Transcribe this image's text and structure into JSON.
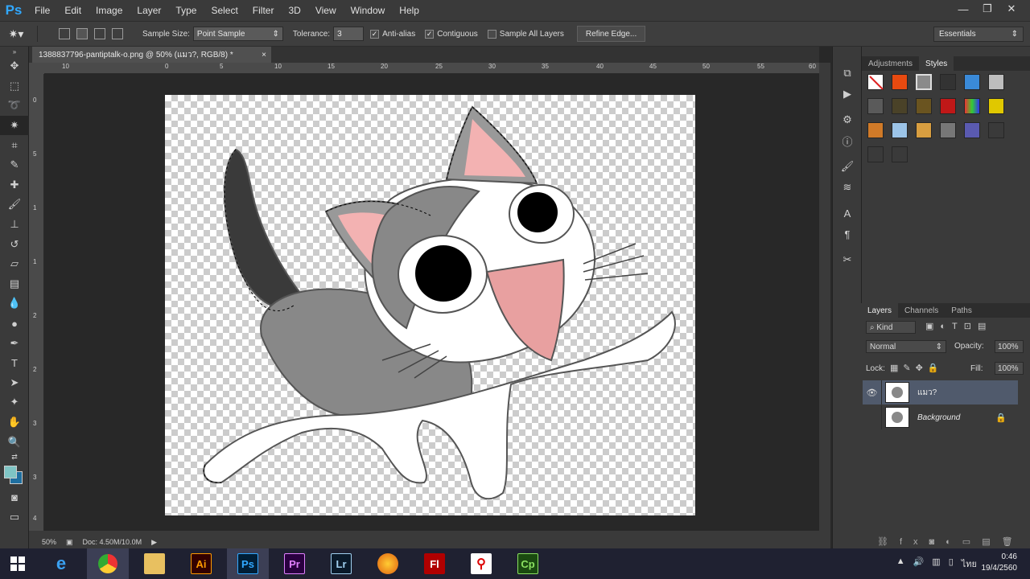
{
  "menu": {
    "logo": "Ps",
    "items": [
      "File",
      "Edit",
      "Image",
      "Layer",
      "Type",
      "Select",
      "Filter",
      "3D",
      "View",
      "Window",
      "Help"
    ]
  },
  "window_controls": {
    "minimize": "—",
    "restore": "❐",
    "close": "✕"
  },
  "options": {
    "sample_size_label": "Sample Size:",
    "sample_size_value": "Point Sample",
    "tolerance_label": "Tolerance:",
    "tolerance_value": "3",
    "antialias_label": "Anti-alias",
    "contiguous_label": "Contiguous",
    "sample_all_layers_label": "Sample All Layers",
    "refine_edge_label": "Refine Edge...",
    "workspace": "Essentials"
  },
  "document": {
    "tab_title": "1388837796-pantiptalk-o.png @ 50% (แมว?, RGB/8) *",
    "tab_close": "×",
    "zoom": "50%",
    "doc_size": "Doc: 4.50M/10.0M"
  },
  "rulers": {
    "top": [
      "10",
      "0",
      "5",
      "10",
      "15",
      "20",
      "25",
      "30",
      "35",
      "40",
      "45",
      "50",
      "55",
      "60"
    ],
    "left": [
      "0",
      "5",
      "1",
      "1",
      "2",
      "2",
      "3",
      "3",
      "4",
      "4",
      "5"
    ]
  },
  "panels": {
    "adjustments_tab": "Adjustments",
    "styles_tab": "Styles",
    "layers_tab": "Layers",
    "channels_tab": "Channels",
    "paths_tab": "Paths",
    "kind_label": "Kind",
    "blend_mode": "Normal",
    "opacity_label": "Opacity:",
    "opacity_value": "100%",
    "lock_label": "Lock:",
    "fill_label": "Fill:",
    "fill_value": "100%"
  },
  "layers": [
    {
      "name": "แมว?",
      "visible": true,
      "selected": true
    },
    {
      "name": "Background",
      "visible": false,
      "selected": false
    }
  ],
  "taskbar": {
    "apps": [
      "Ai",
      "Ps",
      "Pr",
      "Lr",
      "Fl",
      "Cp"
    ],
    "time": "0:46",
    "date": "19/4/2560",
    "lang": "ไทย"
  },
  "colors": {
    "accent": "#31a8ff",
    "selected_layer": "#505a6c",
    "taskbar": "#1f2131"
  }
}
